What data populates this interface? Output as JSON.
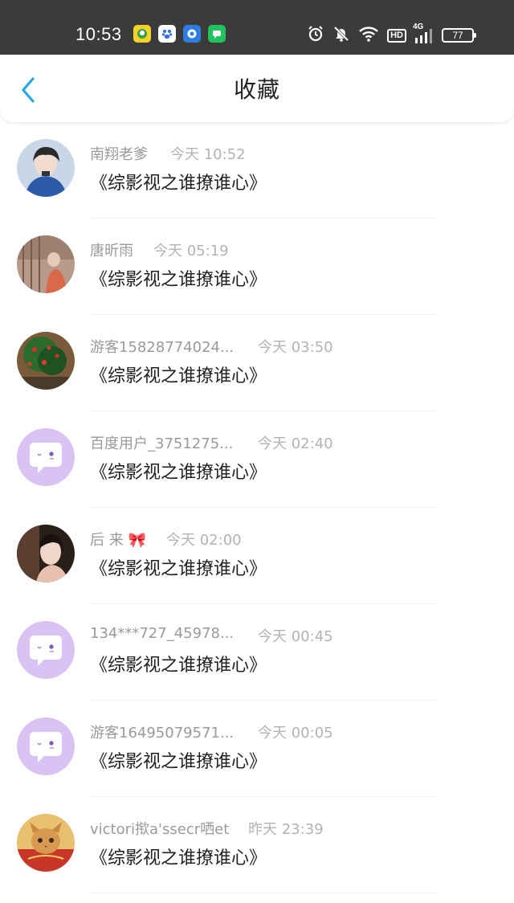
{
  "status_bar": {
    "time": "10:53",
    "battery": "77",
    "network": "4G",
    "hd": "HD"
  },
  "header": {
    "title": "收藏"
  },
  "items": [
    {
      "name": "南翔老爹",
      "time": "今天 10:52",
      "title": "《综影视之谁撩谁心》"
    },
    {
      "name": "唐昕雨",
      "time": "今天 05:19",
      "title": "《综影视之谁撩谁心》"
    },
    {
      "name": "游客15828774024...",
      "time": "今天 03:50",
      "title": "《综影视之谁撩谁心》"
    },
    {
      "name": "百度用户_3751275...",
      "time": "今天 02:40",
      "title": "《综影视之谁撩谁心》"
    },
    {
      "name": "后 来 🎀",
      "time": "今天 02:00",
      "title": "《综影视之谁撩谁心》"
    },
    {
      "name": "134***727_45978...",
      "time": "今天 00:45",
      "title": "《综影视之谁撩谁心》"
    },
    {
      "name": "游客16495079571...",
      "time": "今天 00:05",
      "title": "《综影视之谁撩谁心》"
    },
    {
      "name": "victori揿a'ssecr哂et",
      "time": "昨天 23:39",
      "title": "《综影视之谁撩谁心》"
    }
  ],
  "colors": {
    "accent": "#2aa6e0",
    "status_bar_bg": "#3b3b3b",
    "default_avatar_bg": "#d9c3f3",
    "meta_text": "#9a9a9a",
    "title_text": "#222222"
  }
}
